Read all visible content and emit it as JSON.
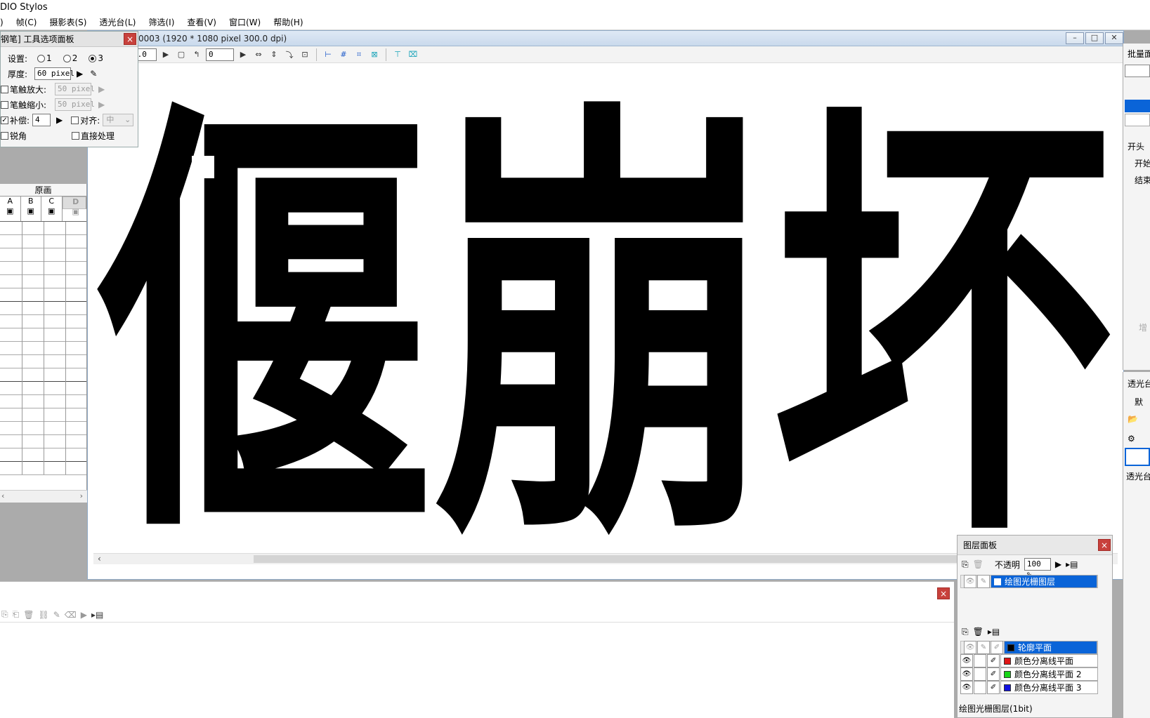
{
  "app": {
    "title": "DIO Stylos"
  },
  "menu": [
    ")",
    "帧(C)",
    "摄影表(S)",
    "透光台(L)",
    "筛选(I)",
    "查看(V)",
    "窗口(W)",
    "帮助(H)"
  ],
  "document": {
    "title": "0003 (1920 * 1080 pixel 300.0 dpi)",
    "zoom": "0.0 %",
    "angle": "0",
    "drawing_text": "偃崩坏"
  },
  "tool_panel": {
    "title": "钢笔] 工具选项面板",
    "setting_label": "设置:",
    "presets": [
      "1",
      "2",
      "3"
    ],
    "selected_preset": "3",
    "thickness_label": "厚度:",
    "thickness_value": "60 pixel",
    "pen_enlarge_label": "笔触放大:",
    "pen_enlarge_value": "50 pixel",
    "pen_shrink_label": "笔触缩小:",
    "pen_shrink_value": "50 pixel",
    "compensation_label": "补偿:",
    "compensation_value": "4",
    "align_label": "对齐:",
    "align_value": "中",
    "sharp_corner_label": "锐角",
    "direct_process_label": "直接处理"
  },
  "timeline": {
    "header": "原画",
    "columns": [
      "A",
      "B",
      "C",
      "D"
    ],
    "selected_column": "D"
  },
  "layer_panel": {
    "title": "图层面板",
    "opacity_label": "不透明",
    "opacity_value": "100 %",
    "raster_layer": "绘图光栅图层",
    "planes": [
      {
        "name": "轮廓平面",
        "color": "#000000",
        "selected": true
      },
      {
        "name": "颜色分离线平面",
        "color": "#e01515",
        "selected": false
      },
      {
        "name": "颜色分离线平面 2",
        "color": "#17d417",
        "selected": false
      },
      {
        "name": "颜色分离线平面 3",
        "color": "#1010e0",
        "selected": false
      }
    ],
    "status": "绘图光栅图层(1bit)"
  },
  "right_panel": {
    "batch_label": "批量面",
    "start_label": "开头",
    "open_label": "开始",
    "end_label": "结束",
    "add_label": "增",
    "lightbox_label": "透光台",
    "default_label": "默",
    "lightbox_label2": "透光台"
  }
}
